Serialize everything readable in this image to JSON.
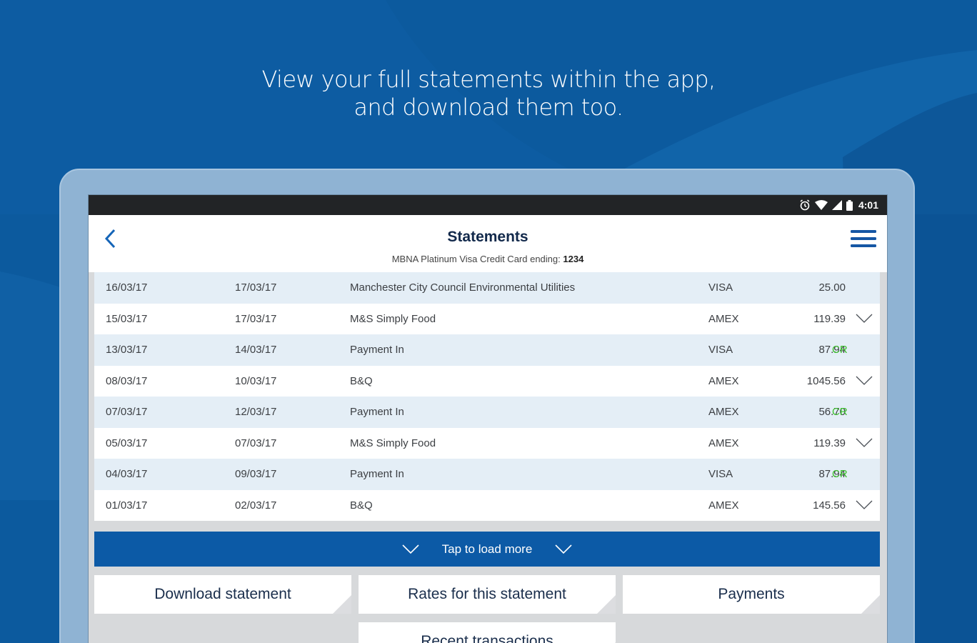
{
  "headline": {
    "line1": "View your full statements within the app,",
    "line2": "and download them too."
  },
  "statusbar": {
    "icons": [
      "alarm-icon",
      "wifi-icon",
      "signal-icon",
      "battery-icon"
    ],
    "time": "4:01"
  },
  "appbar": {
    "title": "Statements",
    "subtitle_prefix": "MBNA Platinum Visa Credit Card ending:",
    "card_ending": "1234",
    "back_icon": "chevron-left-icon",
    "menu_icon": "hamburger-menu-icon"
  },
  "transactions": [
    {
      "date": "16/03/17",
      "posted": "17/03/17",
      "description": "Manchester City Council Environmental Utilities",
      "card": "VISA",
      "amount": "25.00",
      "credit": "",
      "expandable": false
    },
    {
      "date": "15/03/17",
      "posted": "17/03/17",
      "description": "M&S Simply Food",
      "card": "AMEX",
      "amount": "119.39",
      "credit": "",
      "expandable": true
    },
    {
      "date": "13/03/17",
      "posted": "14/03/17",
      "description": "Payment In",
      "card": "VISA",
      "amount": "87.94",
      "credit": "CR",
      "expandable": false
    },
    {
      "date": "08/03/17",
      "posted": "10/03/17",
      "description": "B&Q",
      "card": "AMEX",
      "amount": "1045.56",
      "credit": "",
      "expandable": true
    },
    {
      "date": "07/03/17",
      "posted": "12/03/17",
      "description": "Payment In",
      "card": "AMEX",
      "amount": "56.70",
      "credit": "CR",
      "expandable": false
    },
    {
      "date": "05/03/17",
      "posted": "07/03/17",
      "description": "M&S Simply Food",
      "card": "AMEX",
      "amount": "119.39",
      "credit": "",
      "expandable": true
    },
    {
      "date": "04/03/17",
      "posted": "09/03/17",
      "description": "Payment In",
      "card": "VISA",
      "amount": "87.94",
      "credit": "CR",
      "expandable": false
    },
    {
      "date": "01/03/17",
      "posted": "02/03/17",
      "description": "B&Q",
      "card": "AMEX",
      "amount": "145.56",
      "credit": "",
      "expandable": true
    }
  ],
  "load_more": {
    "label": "Tap to load more"
  },
  "actions": {
    "download": "Download statement",
    "rates": "Rates for this statement",
    "payments": "Payments",
    "recent": "Recent transactions"
  },
  "colors": {
    "brand_blue": "#0c5aa6",
    "credit_green": "#3ec22f",
    "title_navy": "#12294b"
  }
}
